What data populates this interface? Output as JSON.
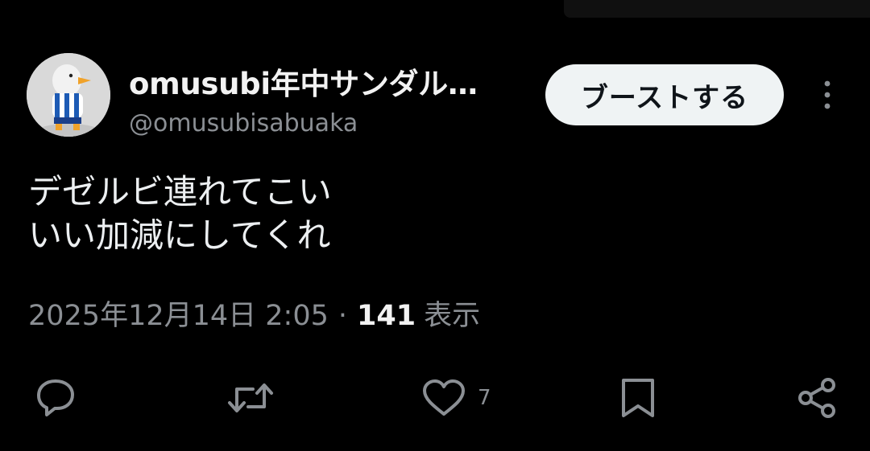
{
  "user": {
    "display_name": "omusubi年中サンダル…",
    "handle": "@omusubisabuaka",
    "avatar": "seagull-mascot-avatar"
  },
  "header": {
    "boost_label": "ブーストする",
    "more_icon": "more-vertical-icon"
  },
  "post": {
    "lines": [
      "デゼルビ連れてこい",
      "いい加減にしてくれ"
    ],
    "timestamp": "2025年12月14日 2:05",
    "separator": "·",
    "views_count": "141",
    "views_label": "表示"
  },
  "actions": {
    "reply_icon": "reply-icon",
    "repost_icon": "repost-icon",
    "like_icon": "heart-icon",
    "like_count": "7",
    "bookmark_icon": "bookmark-icon",
    "share_icon": "share-icon"
  },
  "colors": {
    "background": "#000000",
    "text_primary": "#e7e9ea",
    "text_secondary": "#8b8f94",
    "button_bg": "#eff3f4",
    "button_text": "#0f1419"
  }
}
